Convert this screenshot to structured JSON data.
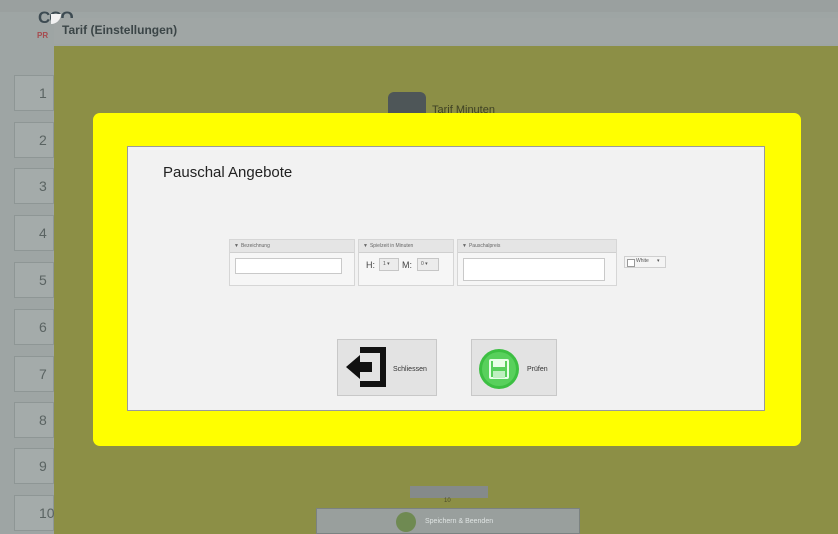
{
  "background": {
    "logo_text": "CCO",
    "logo_sub": "PR",
    "sidebar_numbers": [
      "1",
      "2",
      "3",
      "4",
      "5",
      "6",
      "7",
      "8",
      "9",
      "10"
    ],
    "tarif_label": "Tarif Minuten",
    "pager_number": "10",
    "save_label": "Speichern & Beenden"
  },
  "dialog": {
    "title": "Tarif (Einstellungen)",
    "panel_title": "Pauschal Angebote",
    "columns": {
      "bezeichnung": "Bezeichnung",
      "spielzeit": "Spielzeit in Minuten",
      "pauschalpreis": "Pauschalpreis"
    },
    "hours_label": "H:",
    "hours_value": "1",
    "minutes_label": "M:",
    "minutes_value": "0",
    "color_option": "White",
    "close_button": "Schliessen",
    "check_button": "Prüfen"
  },
  "colors": {
    "frame": "#ffff00",
    "panel": "#f2f2f2",
    "check_icon": "#3cbf42"
  }
}
